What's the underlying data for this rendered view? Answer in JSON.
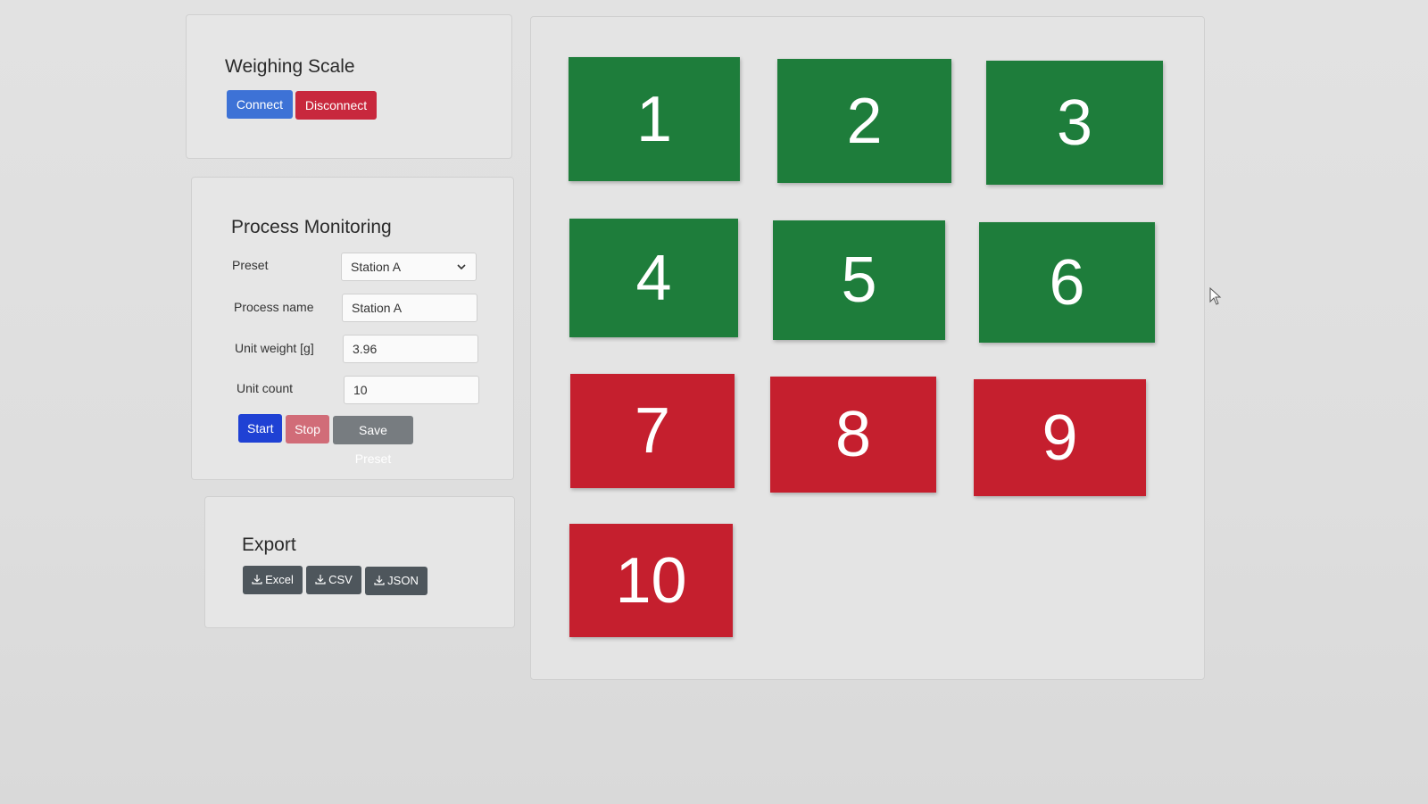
{
  "scale": {
    "title": "Weighing Scale",
    "connect_label": "Connect",
    "disconnect_label": "Disconnect"
  },
  "process": {
    "title": "Process Monitoring",
    "preset_label": "Preset",
    "preset_value": "Station A",
    "name_label": "Process name",
    "name_value": "Station A",
    "weight_label": "Unit weight [g]",
    "weight_value": "3.96",
    "count_label": "Unit count",
    "count_value": "10",
    "start_label": "Start",
    "stop_label": "Stop",
    "save_label": "Save Preset"
  },
  "export": {
    "title": "Export",
    "excel_label": "Excel",
    "csv_label": "CSV",
    "json_label": "JSON",
    "icon": "download-icon"
  },
  "tiles": [
    {
      "label": "1",
      "status": "ok"
    },
    {
      "label": "2",
      "status": "ok"
    },
    {
      "label": "3",
      "status": "ok"
    },
    {
      "label": "4",
      "status": "ok"
    },
    {
      "label": "5",
      "status": "ok"
    },
    {
      "label": "6",
      "status": "ok"
    },
    {
      "label": "7",
      "status": "bad"
    },
    {
      "label": "8",
      "status": "bad"
    },
    {
      "label": "9",
      "status": "bad"
    },
    {
      "label": "10",
      "status": "bad"
    }
  ],
  "colors": {
    "ok": "#1e7d3b",
    "bad": "#c51f2e",
    "primary": "#3d72d6",
    "danger": "#c8283d"
  }
}
